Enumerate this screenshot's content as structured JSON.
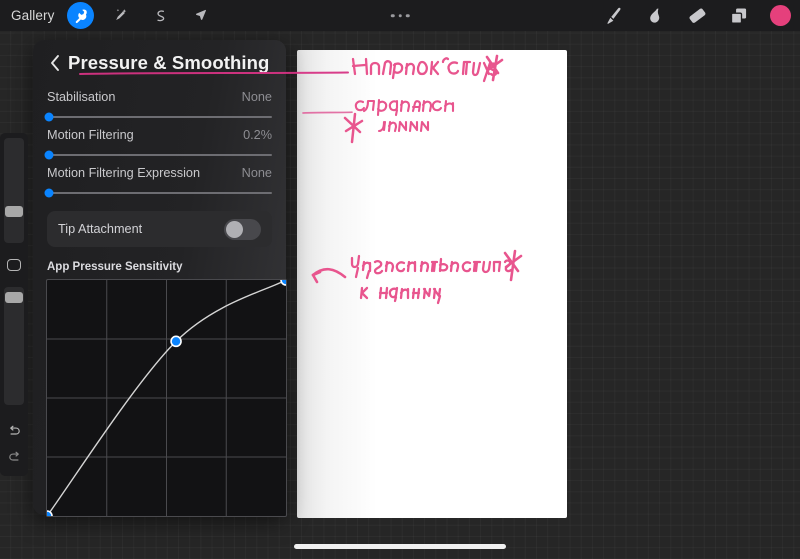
{
  "topbar": {
    "gallery_label": "Gallery",
    "left_tools": [
      {
        "name": "wrench-icon",
        "label": "Actions",
        "active": true
      },
      {
        "name": "magic-wand-icon",
        "label": "Adjustments",
        "active": false
      },
      {
        "name": "s-curve-selection-icon",
        "label": "Selection",
        "active": false
      },
      {
        "name": "arrow-transform-icon",
        "label": "Transform",
        "active": false
      }
    ],
    "more_menu": "…",
    "right_tools": [
      {
        "name": "paintbrush-icon",
        "label": "Paint"
      },
      {
        "name": "smudge-icon",
        "label": "Smudge"
      },
      {
        "name": "eraser-icon",
        "label": "Erase"
      },
      {
        "name": "layers-icon",
        "label": "Layers"
      }
    ],
    "color_swatch": "#e5407c",
    "accent_blue": "#0a84ff"
  },
  "sidebar": {
    "brush_size_label": "Brush Size",
    "brush_size_knob_pct": 72,
    "modify_label": "Modify",
    "opacity_label": "Opacity",
    "opacity_knob_pct": 5,
    "undo_label": "Undo",
    "redo_label": "Redo"
  },
  "panel": {
    "back_label": "Back",
    "title": "Pressure & Smoothing",
    "settings": [
      {
        "label": "Stabilisation",
        "value": "None",
        "knob_pct": 0
      },
      {
        "label": "Motion Filtering",
        "value": "0.2%",
        "knob_pct": 0
      },
      {
        "label": "Motion Filtering Expression",
        "value": "None",
        "knob_pct": 0
      }
    ],
    "tip_attachment": {
      "label": "Tip Attachment",
      "value": "Off"
    },
    "curve": {
      "label": "App Pressure Sensitivity"
    }
  },
  "chart_data": {
    "type": "line",
    "title": "App Pressure Sensitivity",
    "xlabel": "",
    "ylabel": "",
    "xlim": [
      0,
      1
    ],
    "ylim": [
      0,
      1
    ],
    "grid": true,
    "grid_divisions": 4,
    "control_points": [
      {
        "x": 0.0,
        "y": 0.0
      },
      {
        "x": 0.54,
        "y": 0.74
      },
      {
        "x": 1.0,
        "y": 1.0
      }
    ],
    "curve_color": "#d5d5d5",
    "point_color": "#0a84ff"
  },
  "annotations": {
    "note_1": "Настройка Стилуса",
    "note_2_line_1": "сглаживание",
    "note_2_line_2": "линии",
    "note_3_line_1": "Чувствительность",
    "note_3_line_2": "к нажиму",
    "ink_color": "#e8558e"
  },
  "system": {
    "home_indicator": "Home Indicator"
  }
}
